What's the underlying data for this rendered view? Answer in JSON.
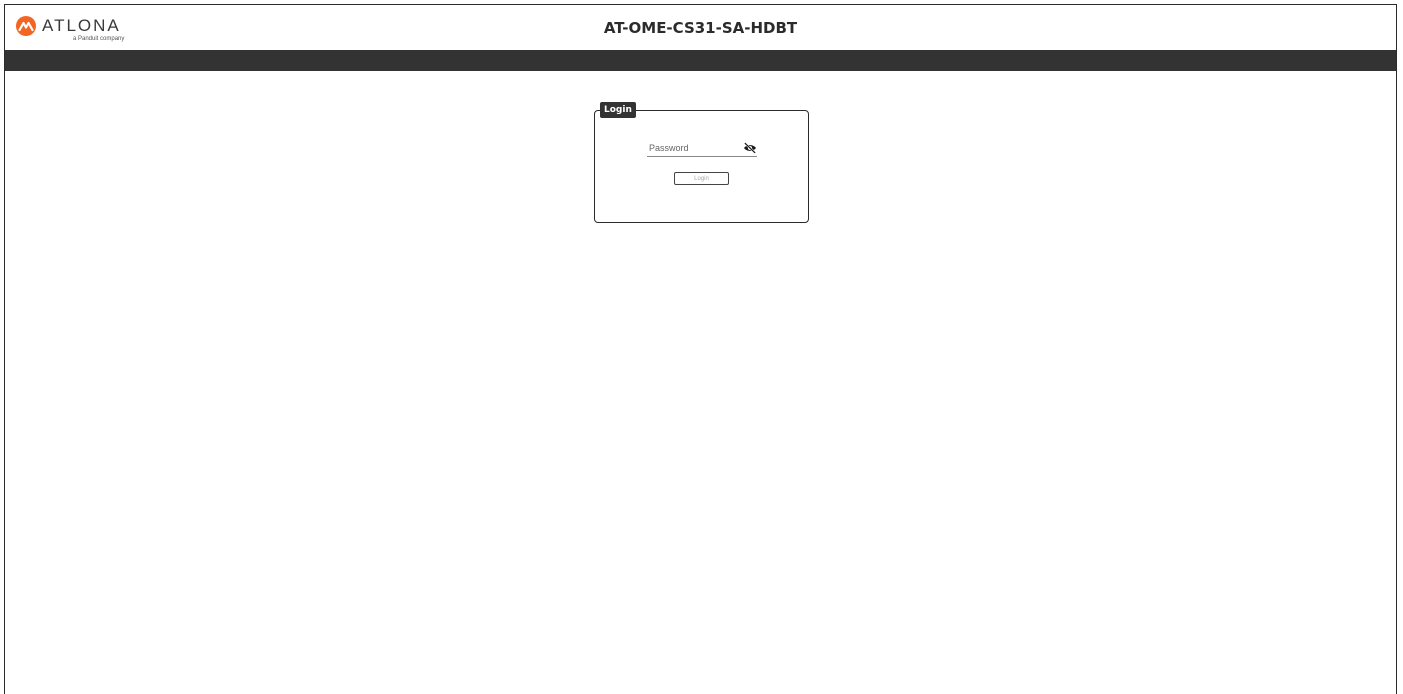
{
  "header": {
    "logo_text": "ATLONA",
    "logo_sub": "a Panduit company",
    "title": "AT-OME-CS31-SA-HDBT"
  },
  "login": {
    "legend": "Login",
    "password_placeholder": "Password",
    "password_value": "",
    "button_label": "Login",
    "visibility_icon": "eye-slash-icon"
  },
  "colors": {
    "brand_orange": "#f26522",
    "nav_bar": "#333333",
    "border": "#2b2b2b"
  }
}
